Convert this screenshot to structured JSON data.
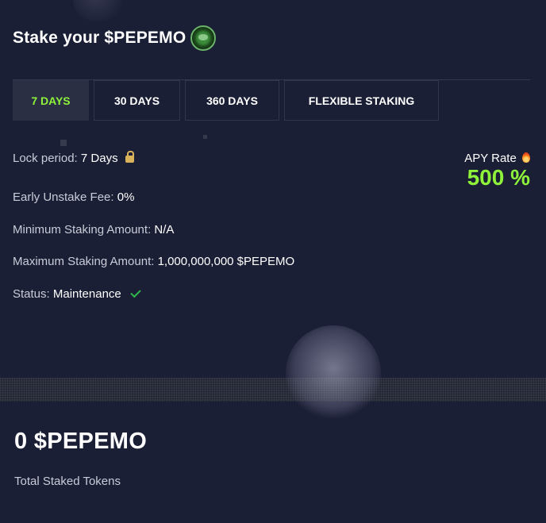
{
  "header": {
    "title": "Stake your $PEPEMO",
    "logo_icon": "pepemo-token-logo"
  },
  "tabs": [
    {
      "label": "7 DAYS",
      "active": true
    },
    {
      "label": "30 DAYS",
      "active": false
    },
    {
      "label": "360 DAYS",
      "active": false
    },
    {
      "label": "FLEXIBLE STAKING",
      "active": false
    }
  ],
  "details": {
    "lock_period": {
      "label": "Lock period:",
      "value": "7 Days",
      "icon": "lock-icon"
    },
    "early_unstake_fee": {
      "label": "Early Unstake Fee:",
      "value": "0%"
    },
    "minimum_staking": {
      "label": "Minimum Staking Amount:",
      "value": "N/A"
    },
    "maximum_staking": {
      "label": "Maximum Staking Amount:",
      "value": "1,000,000,000 $PEPEMO"
    },
    "status": {
      "label": "Status:",
      "value": "Maintenance",
      "icon": "check-icon"
    }
  },
  "apy": {
    "label": "APY Rate",
    "icon": "fire-icon",
    "value": "500 %"
  },
  "totals": {
    "amount": "0 $PEPEMO",
    "label": "Total Staked Tokens"
  },
  "colors": {
    "accent_green": "#8ef23a",
    "background": "#1b1f35",
    "tab_active_bg": "#2a2f43",
    "status_check": "#2eb84a",
    "lock": "#d9b25a"
  }
}
